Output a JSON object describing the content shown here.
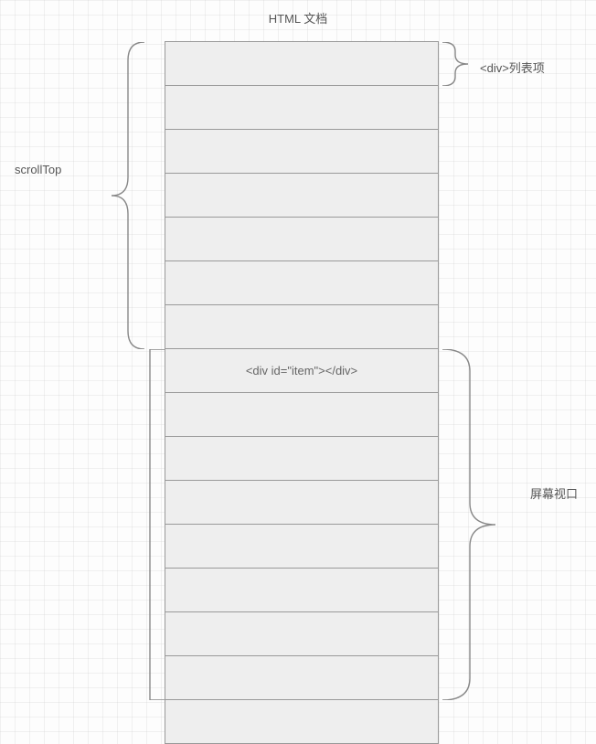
{
  "title": "HTML 文档",
  "labels": {
    "scrolltop": "scrollTop",
    "listitem": "<div>列表项",
    "viewport": "屏幕视口"
  },
  "rows": {
    "r8": "<div id=\"item\"></div>"
  }
}
